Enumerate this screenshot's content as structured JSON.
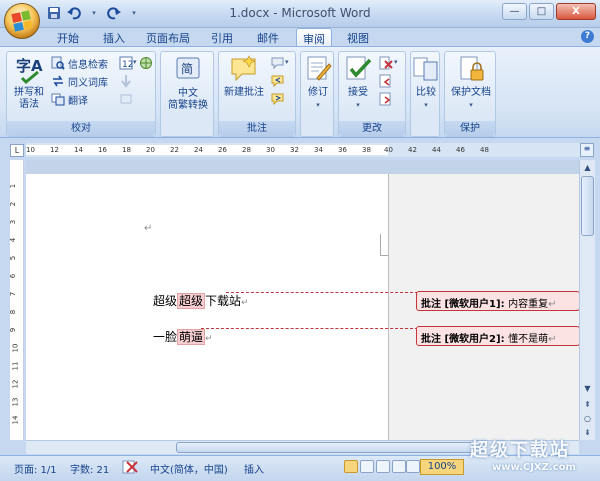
{
  "window": {
    "title": "1.docx - Microsoft Word",
    "minimize": "—",
    "maximize": "□",
    "close": "X"
  },
  "tabs": [
    "开始",
    "插入",
    "页面布局",
    "引用",
    "邮件",
    "审阅",
    "视图"
  ],
  "active_tab": "审阅",
  "ribbon": {
    "proofing": {
      "label": "校对",
      "spelling": "拼写和\n语法",
      "research": "信息检索",
      "thesaurus": "同义词库",
      "translate": "翻译"
    },
    "chinese": {
      "label": "中文\n简繁转换"
    },
    "comments": {
      "label": "批注",
      "new_comment": "新建批注"
    },
    "tracking": {
      "label": "修订"
    },
    "changes": {
      "label": "更改",
      "accept": "接受"
    },
    "compare": {
      "label": "比较"
    },
    "protect": {
      "label": "保护",
      "protect_doc": "保护文档"
    }
  },
  "ruler": {
    "corner": "L",
    "ticks": [
      "10",
      "12",
      "14",
      "16",
      "18",
      "20",
      "22",
      "24",
      "26",
      "28",
      "30",
      "32",
      "34",
      "36",
      "38",
      "40",
      "42",
      "44",
      "46",
      "48"
    ],
    "vticks": [
      "1",
      "2",
      "3",
      "4",
      "5",
      "6",
      "7",
      "8",
      "9",
      "10",
      "11",
      "12",
      "13",
      "14",
      "15"
    ]
  },
  "document": {
    "para_mark": "↵",
    "line1": {
      "pre": "超级",
      "hl": "超级",
      "post": "下载站"
    },
    "line2": {
      "pre": "一脸",
      "hl": "萌逼",
      "post": ""
    }
  },
  "comments": [
    {
      "prefix": "批注 [",
      "author": "微软用户1]: ",
      "text": "内容重复"
    },
    {
      "prefix": "批注 [",
      "author": "微软用户2]: ",
      "text": "懂不是萌"
    }
  ],
  "status": {
    "page": "页面: 1/1",
    "words": "字数: 21",
    "language": "中文(简体，中国)",
    "mode": "插入",
    "zoom": "100%"
  },
  "watermark": {
    "title": "超级下载站",
    "url": "www.CJXZ.com"
  },
  "colors": {
    "comment_border": "#c6343b",
    "comment_fill": "#fbe3e4",
    "highlight": "#f7cfd0",
    "ribbon_text": "#15428b"
  }
}
